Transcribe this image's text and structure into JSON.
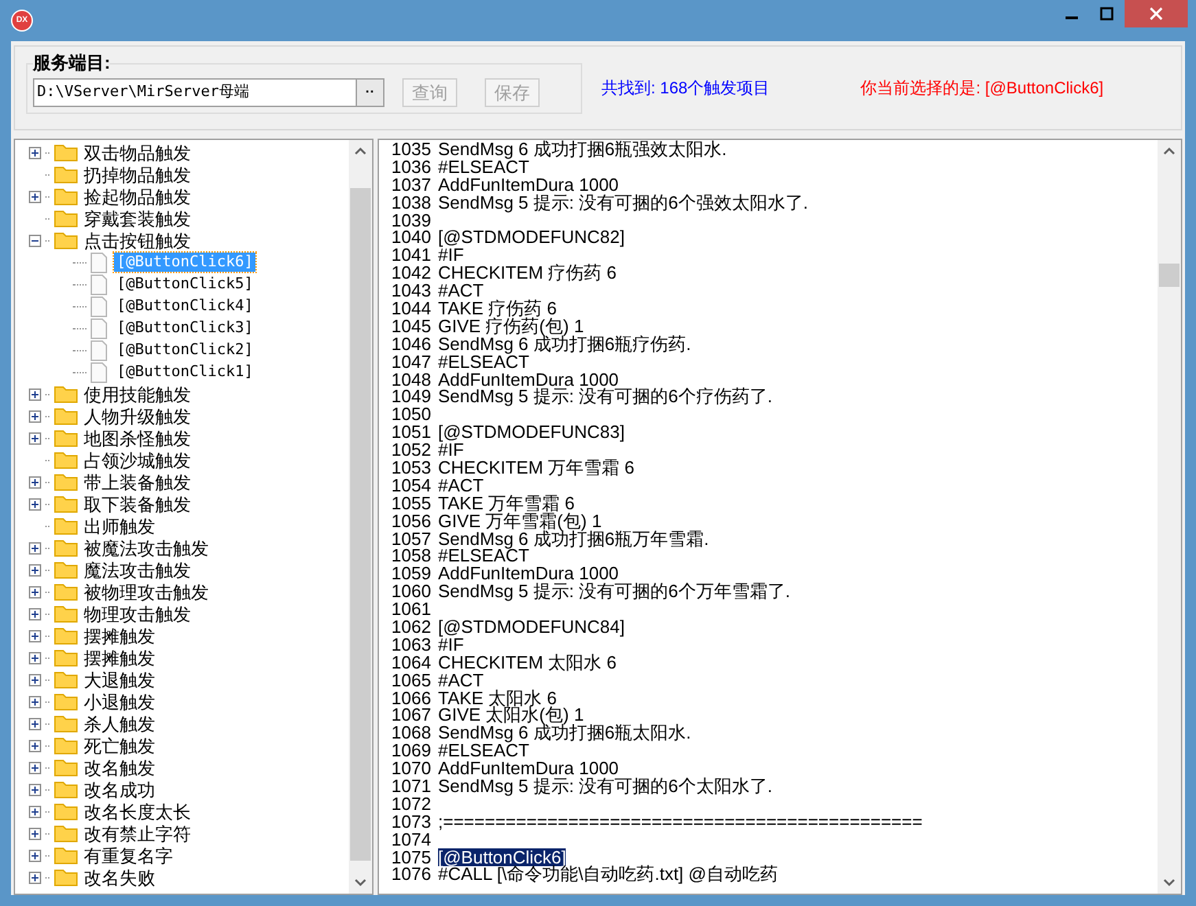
{
  "window": {
    "app_icon_text": "DX"
  },
  "server_dir": {
    "label": "服务端目:",
    "value": "D:\\VServer\\MirServer母端",
    "browse_label": "··"
  },
  "buttons": [
    {
      "label": "查询",
      "disabled": true
    },
    {
      "label": "保存",
      "disabled": true
    }
  ],
  "found_text": "共找到: 168个触发项目",
  "selection_text": "你当前选择的是: [@ButtonClick6]",
  "tree": [
    {
      "label": "双击物品触发",
      "expanded": false
    },
    {
      "label": "扔掉物品触发"
    },
    {
      "label": "捡起物品触发",
      "expanded": false
    },
    {
      "label": "穿戴套装触发"
    },
    {
      "label": "点击按钮触发",
      "expanded": true,
      "children": [
        {
          "label": "[@ButtonClick6]",
          "selected": true
        },
        {
          "label": "[@ButtonClick5]",
          "selected": false
        },
        {
          "label": "[@ButtonClick4]",
          "selected": false
        },
        {
          "label": "[@ButtonClick3]",
          "selected": false
        },
        {
          "label": "[@ButtonClick2]",
          "selected": false
        },
        {
          "label": "[@ButtonClick1]",
          "selected": false
        }
      ]
    },
    {
      "label": "使用技能触发",
      "expanded": false
    },
    {
      "label": "人物升级触发",
      "expanded": false
    },
    {
      "label": "地图杀怪触发",
      "expanded": false
    },
    {
      "label": "占领沙城触发"
    },
    {
      "label": "带上装备触发",
      "expanded": false
    },
    {
      "label": "取下装备触发",
      "expanded": false
    },
    {
      "label": "出师触发"
    },
    {
      "label": "被魔法攻击触发",
      "expanded": false
    },
    {
      "label": "魔法攻击触发",
      "expanded": false
    },
    {
      "label": "被物理攻击触发",
      "expanded": false
    },
    {
      "label": "物理攻击触发",
      "expanded": false
    },
    {
      "label": "摆摊触发",
      "expanded": false
    },
    {
      "label": "摆摊触发",
      "expanded": false
    },
    {
      "label": "大退触发",
      "expanded": false
    },
    {
      "label": "小退触发",
      "expanded": false
    },
    {
      "label": "杀人触发",
      "expanded": false
    },
    {
      "label": "死亡触发",
      "expanded": false
    },
    {
      "label": "改名触发",
      "expanded": false
    },
    {
      "label": "改名成功",
      "expanded": false
    },
    {
      "label": "改名长度太长",
      "expanded": false
    },
    {
      "label": "改有禁止字符",
      "expanded": false
    },
    {
      "label": "有重复名字",
      "expanded": false
    },
    {
      "label": "改名失败",
      "expanded": false
    }
  ],
  "code_lines": [
    {
      "number": "1035",
      "text": "SendMsg 6 成功打捆6瓶强效太阳水.",
      "highlighted": false
    },
    {
      "number": "1036",
      "text": "#ELSEACT",
      "highlighted": false
    },
    {
      "number": "1037",
      "text": "AddFunItemDura 1000",
      "highlighted": false
    },
    {
      "number": "1038",
      "text": "SendMsg 5 提示: 没有可捆的6个强效太阳水了.",
      "highlighted": false
    },
    {
      "number": "1039"
    },
    {
      "number": "1040",
      "text": "[@STDMODEFUNC82]",
      "highlighted": false
    },
    {
      "number": "1041",
      "text": "#IF",
      "highlighted": false
    },
    {
      "number": "1042",
      "text": "CHECKITEM 疗伤药 6",
      "highlighted": false
    },
    {
      "number": "1043",
      "text": "#ACT",
      "highlighted": false
    },
    {
      "number": "1044",
      "text": "TAKE 疗伤药 6",
      "highlighted": false
    },
    {
      "number": "1045",
      "text": "GIVE 疗伤药(包) 1",
      "highlighted": false
    },
    {
      "number": "1046",
      "text": "SendMsg 6 成功打捆6瓶疗伤药.",
      "highlighted": false
    },
    {
      "number": "1047",
      "text": "#ELSEACT",
      "highlighted": false
    },
    {
      "number": "1048",
      "text": "AddFunItemDura 1000",
      "highlighted": false
    },
    {
      "number": "1049",
      "text": "SendMsg 5 提示: 没有可捆的6个疗伤药了.",
      "highlighted": false
    },
    {
      "number": "1050"
    },
    {
      "number": "1051",
      "text": "[@STDMODEFUNC83]",
      "highlighted": false
    },
    {
      "number": "1052",
      "text": "#IF",
      "highlighted": false
    },
    {
      "number": "1053",
      "text": "CHECKITEM 万年雪霜 6",
      "highlighted": false
    },
    {
      "number": "1054",
      "text": "#ACT",
      "highlighted": false
    },
    {
      "number": "1055",
      "text": "TAKE 万年雪霜 6",
      "highlighted": false
    },
    {
      "number": "1056",
      "text": "GIVE 万年雪霜(包) 1",
      "highlighted": false
    },
    {
      "number": "1057",
      "text": "SendMsg 6 成功打捆6瓶万年雪霜.",
      "highlighted": false
    },
    {
      "number": "1058",
      "text": "#ELSEACT",
      "highlighted": false
    },
    {
      "number": "1059",
      "text": "AddFunItemDura 1000",
      "highlighted": false
    },
    {
      "number": "1060",
      "text": "SendMsg 5 提示: 没有可捆的6个万年雪霜了.",
      "highlighted": false
    },
    {
      "number": "1061"
    },
    {
      "number": "1062",
      "text": "[@STDMODEFUNC84]",
      "highlighted": false
    },
    {
      "number": "1063",
      "text": "#IF",
      "highlighted": false
    },
    {
      "number": "1064",
      "text": "CHECKITEM 太阳水 6",
      "highlighted": false
    },
    {
      "number": "1065",
      "text": "#ACT",
      "highlighted": false
    },
    {
      "number": "1066",
      "text": "TAKE 太阳水 6",
      "highlighted": false
    },
    {
      "number": "1067",
      "text": "GIVE 太阳水(包) 1",
      "highlighted": false
    },
    {
      "number": "1068",
      "text": "SendMsg 6 成功打捆6瓶太阳水.",
      "highlighted": false
    },
    {
      "number": "1069",
      "text": "#ELSEACT",
      "highlighted": false
    },
    {
      "number": "1070",
      "text": "AddFunItemDura 1000",
      "highlighted": false
    },
    {
      "number": "1071",
      "text": "SendMsg 5 提示: 没有可捆的6个太阳水了.",
      "highlighted": false
    },
    {
      "number": "1072"
    },
    {
      "number": "1073",
      "text": ";==============================================",
      "highlighted": false
    },
    {
      "number": "1074"
    },
    {
      "number": "1075",
      "text": "[@ButtonClick6]",
      "highlighted": true
    },
    {
      "number": "1076",
      "text": "#CALL [\\命令功能\\自动吃药.txt] @自动吃药"
    }
  ]
}
